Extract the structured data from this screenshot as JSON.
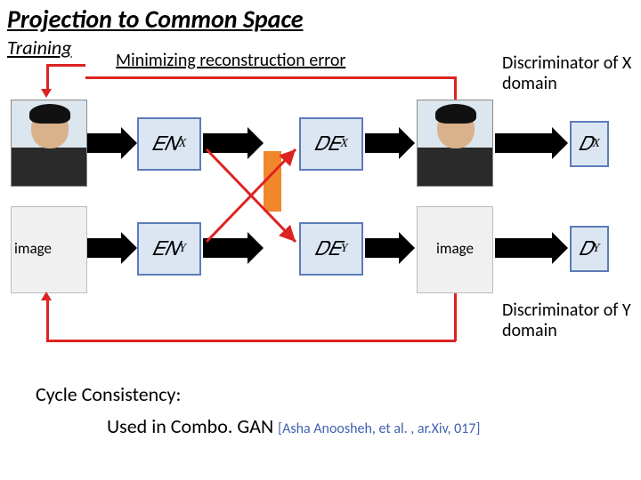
{
  "title": "Projection to Common Space",
  "subtitle": "Training",
  "minimize_label": "Minimizing reconstruction error",
  "discriminator_x_label": "Discriminator of X domain",
  "discriminator_y_label": "Discriminator of Y domain",
  "image_label_left": "image",
  "image_label_right": "image",
  "blocks": {
    "enx": "𝐸𝑁",
    "enx_sub": "X",
    "eny": "𝐸𝑁",
    "eny_sub": "Y",
    "dex": "𝐷𝐸",
    "dex_sub": "X",
    "dey": "𝐷𝐸",
    "dey_sub": "Y",
    "dx": "𝐷",
    "dx_sub": "X",
    "dy": "𝐷",
    "dy_sub": "Y"
  },
  "cycle_label": "Cycle Consistency:",
  "usedin_label": "Used in Combo. GAN",
  "citation": "[Asha Anoosheh, et al. , ar.Xiv, 017]"
}
